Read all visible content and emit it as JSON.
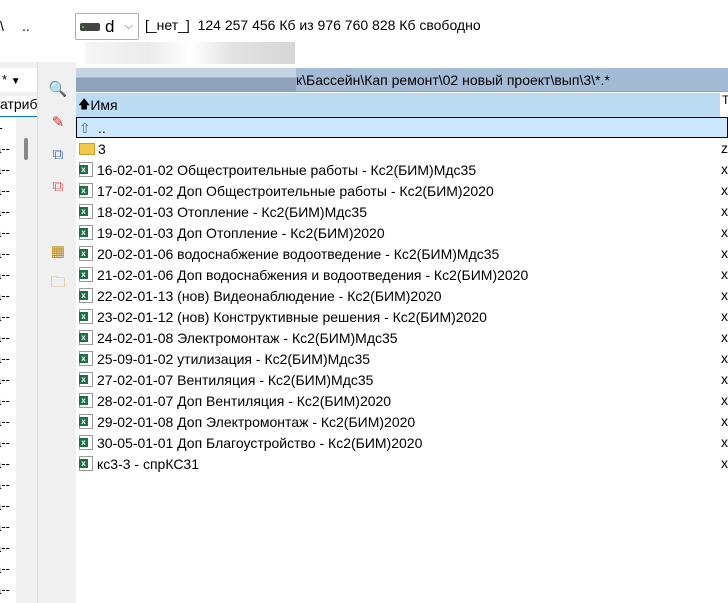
{
  "left_panel": {
    "path_fragment": "\\",
    "dots": "..",
    "header_star": "*",
    "header_arrow": "▼",
    "column_label": "атрибу",
    "attributes": [
      "--",
      "a--",
      "a--",
      "a--",
      "a--",
      "a--",
      "a--",
      "a--",
      "a--",
      "a--",
      "a--",
      "a--",
      "a--",
      "a--",
      "a--",
      "a--",
      "a--",
      "a--",
      "a--",
      "a--",
      "a--",
      "a--",
      "a--"
    ]
  },
  "drive": {
    "letter": "d",
    "chevron": "⌵",
    "label": "[_нет_]",
    "free_text": "124 257 456 Кб из 976 760 828 Кб свободно"
  },
  "path": "к\\Бассейн\\Кап ремонт\\02 новый проект\\вып\\3\\*.*",
  "columns": {
    "name": "Имя",
    "sort_arrow": "🡅",
    "ext_fragment": "T"
  },
  "rows": [
    {
      "name": "..",
      "type": "up",
      "ext": ""
    },
    {
      "name": "3",
      "type": "folder",
      "ext": "z"
    },
    {
      "name": "16-02-01-02 Общестроительные работы - Кс2(БИМ)Мдс35",
      "type": "xl",
      "ext": "x"
    },
    {
      "name": "17-02-01-02 Доп Общестроительные работы - Кс2(БИМ)2020",
      "type": "xl",
      "ext": "x"
    },
    {
      "name": "18-02-01-03 Отопление - Кс2(БИМ)Мдс35",
      "type": "xl",
      "ext": "x"
    },
    {
      "name": "19-02-01-03 Доп Отопление - Кс2(БИМ)2020",
      "type": "xl",
      "ext": "x"
    },
    {
      "name": "20-02-01-06 водоснабжение водоотведение - Кс2(БИМ)Мдс35",
      "type": "xl",
      "ext": "x"
    },
    {
      "name": "21-02-01-06 Доп водоснабжения и водоотведения - Кс2(БИМ)2020",
      "type": "xl",
      "ext": "x"
    },
    {
      "name": "22-02-01-13 (нов) Видеонаблюдение - Кс2(БИМ)2020",
      "type": "xl",
      "ext": "x"
    },
    {
      "name": "23-02-01-12 (нов) Конструктивные решения - Кс2(БИМ)2020",
      "type": "xl",
      "ext": "x"
    },
    {
      "name": "24-02-01-08 Электромонтаж - Кс2(БИМ)Мдс35",
      "type": "xl",
      "ext": "x"
    },
    {
      "name": "25-09-01-02 утилизация - Кс2(БИМ)Мдс35",
      "type": "xl",
      "ext": "x"
    },
    {
      "name": "27-02-01-07 Вентиляция - Кс2(БИМ)Мдс35",
      "type": "xl",
      "ext": "x"
    },
    {
      "name": "28-02-01-07 Доп Вентиляция - Кс2(БИМ)2020",
      "type": "xl",
      "ext": "x"
    },
    {
      "name": "29-02-01-08 Доп Электромонтаж - Кс2(БИМ)2020",
      "type": "xl",
      "ext": "x"
    },
    {
      "name": "30-05-01-01 Доп Благоустройство - Кс2(БИМ)2020",
      "type": "xl",
      "ext": "x"
    },
    {
      "name": "кс3-3 - спрКС31",
      "type": "xl",
      "ext": "x"
    }
  ],
  "toolbar": [
    {
      "icon": "view-file-icon",
      "glyph": "🔍"
    },
    {
      "icon": "edit-file-icon",
      "glyph": "✎"
    },
    {
      "icon": "copy-icon",
      "glyph": "⧉"
    },
    {
      "icon": "move-icon",
      "glyph": "⧉"
    },
    {
      "icon": "pack-icon",
      "glyph": "▦"
    },
    {
      "icon": "new-folder-icon",
      "glyph": "🗀"
    }
  ]
}
